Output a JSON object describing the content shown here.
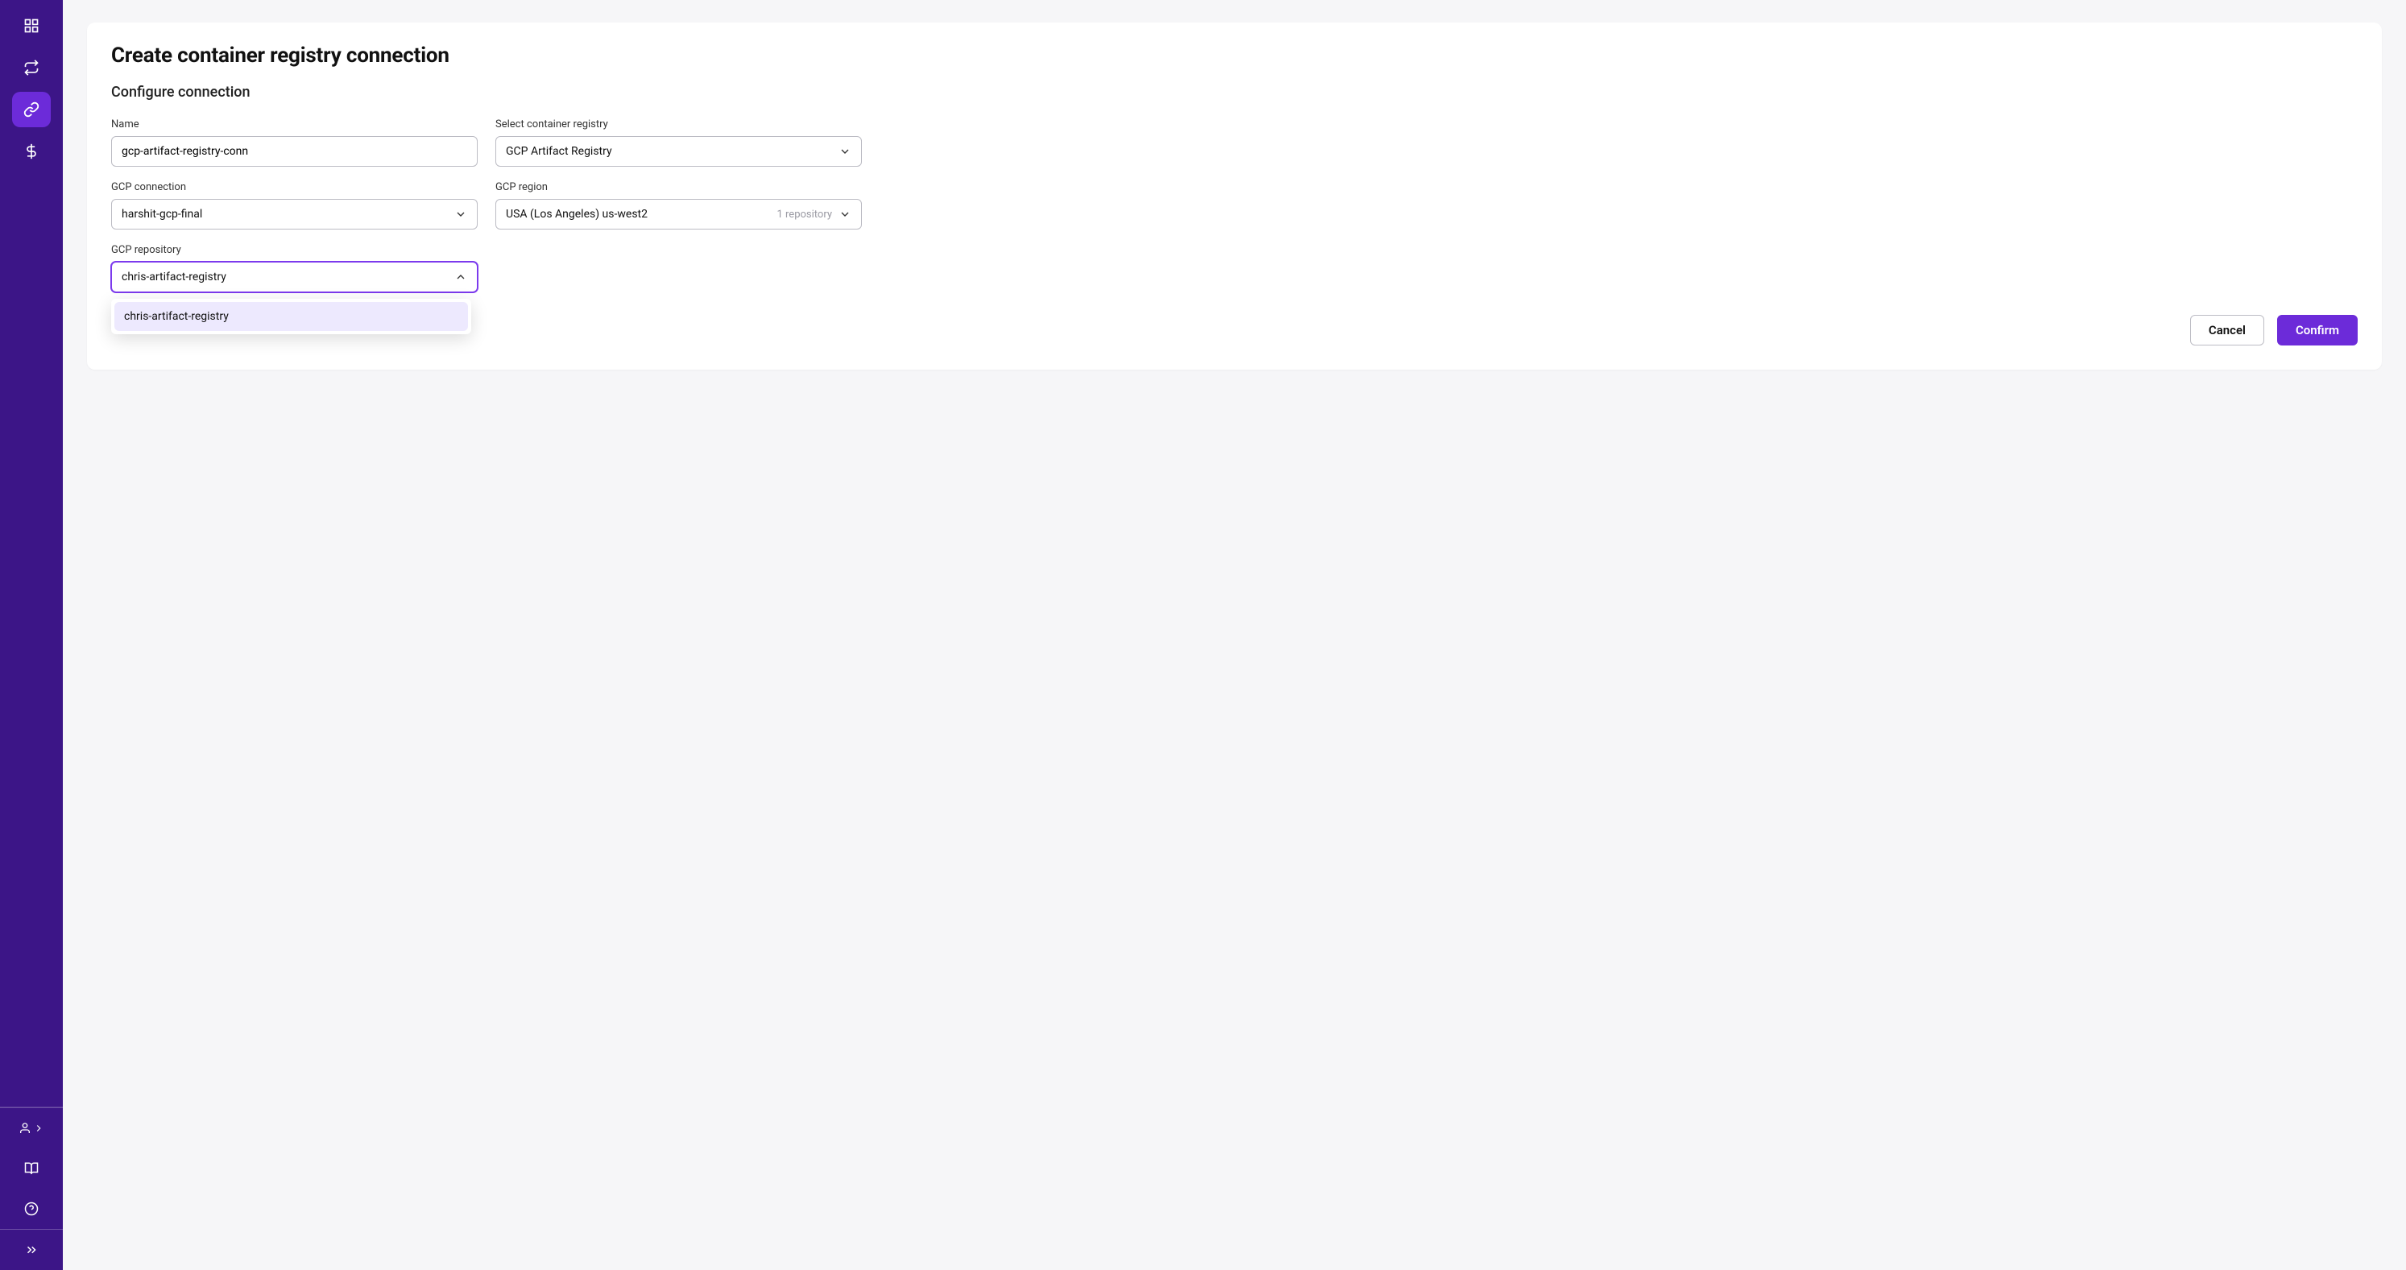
{
  "sidebar": {
    "nav": [
      {
        "name": "nav-dashboard",
        "icon": "dashboard-icon"
      },
      {
        "name": "nav-compare",
        "icon": "swap-icon"
      },
      {
        "name": "nav-connections",
        "icon": "link-icon",
        "active": true
      },
      {
        "name": "nav-billing",
        "icon": "dollar-icon"
      }
    ]
  },
  "page": {
    "title": "Create container registry connection",
    "subtitle": "Configure connection"
  },
  "fields": {
    "name": {
      "label": "Name",
      "value": "gcp-artifact-registry-conn"
    },
    "registry": {
      "label": "Select container registry",
      "value": "GCP Artifact Registry"
    },
    "gcp_conn": {
      "label": "GCP connection",
      "value": "harshit-gcp-final"
    },
    "region": {
      "label": "GCP region",
      "value": "USA (Los Angeles) us-west2",
      "repo_count": "1 repository"
    },
    "repository": {
      "label": "GCP repository",
      "value": "chris-artifact-registry"
    }
  },
  "dropdown": {
    "options": [
      "chris-artifact-registry"
    ]
  },
  "actions": {
    "cancel": "Cancel",
    "confirm": "Confirm"
  }
}
